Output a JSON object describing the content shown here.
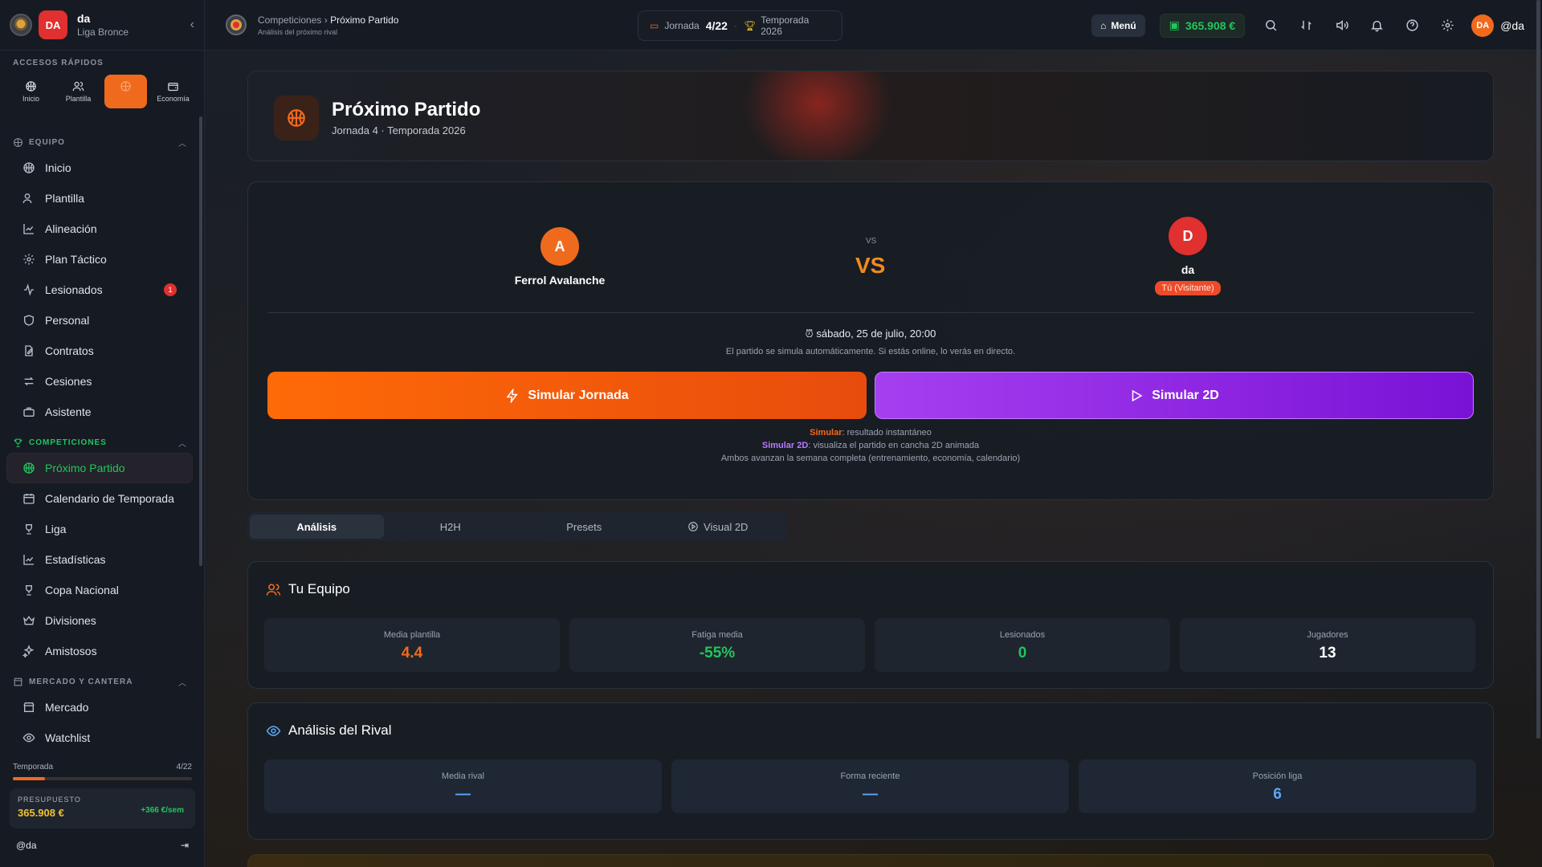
{
  "sidebar": {
    "club_name": "da",
    "league": "Liga Bronce",
    "avatar_initials": "DA",
    "quick_title": "Accesos rápidos",
    "quick": [
      {
        "label": "Inicio",
        "icon": "basketball-icon"
      },
      {
        "label": "Plantilla",
        "icon": "users-icon"
      },
      {
        "label": "Partido",
        "icon": "basketball-icon",
        "active": true
      },
      {
        "label": "Economía",
        "icon": "wallet-icon"
      }
    ],
    "group_equipo": "Equipo",
    "group_competiciones": "Competiciones",
    "group_mercado": "Mercado y cantera",
    "equipo_items": [
      "Inicio",
      "Plantilla",
      "Alineación",
      "Plan Táctico",
      "Lesionados",
      "Personal",
      "Contratos",
      "Cesiones",
      "Asistente"
    ],
    "lesionados_badge": "1",
    "competiciones_items": [
      "Próximo Partido",
      "Calendario de Temporada",
      "Liga",
      "Estadísticas",
      "Copa Nacional",
      "Divisiones",
      "Amistosos"
    ],
    "mercado_items": [
      "Mercado",
      "Watchlist"
    ],
    "season_label": "Temporada",
    "season_progress": "4/22",
    "season_fraction": 0.18,
    "budget_label": "Presupuesto",
    "budget_value": "365.908 €",
    "budget_weekly": "+366 €/sem",
    "handle": "@da"
  },
  "topbar": {
    "crumb_parent": "Competiciones",
    "crumb_current": "Próximo Partido",
    "crumb_sub": "Análisis del próximo rival",
    "jornada_label": "Jornada",
    "jornada_value": "4/22",
    "temporada": "Temporada 2026",
    "menu_label": "Menú",
    "money": "365.908 €",
    "avatar_initials": "DA",
    "handle": "@da"
  },
  "hero": {
    "title": "Próximo Partido",
    "subtitle": "Jornada 4 · Temporada 2026"
  },
  "match": {
    "home_initial": "A",
    "home_name": "Ferrol Avalanche",
    "home_color": "#f06a1e",
    "away_initial": "D",
    "away_name": "da",
    "away_color": "#e0302f",
    "away_tag": "Tú (Visitante)",
    "vs_small": "VS",
    "vs_big": "VS",
    "datetime": "sábado, 25 de julio, 20:00",
    "note": "El partido se simula automáticamente. Si estás online, lo verás en directo.",
    "simulate_label": "Simular Jornada",
    "simulate2d_label": "Simular 2D",
    "legend_sim_key": "Simular",
    "legend_sim_text": ": resultado instantáneo",
    "legend_2d_key": "Simular 2D",
    "legend_2d_text": ": visualiza el partido en cancha 2D animada",
    "legend_line3": "Ambos avanzan la semana completa (entrenamiento, economía, calendario)"
  },
  "tabs": [
    "Análisis",
    "H2H",
    "Presets",
    "Visual 2D"
  ],
  "your_team": {
    "title": "Tu Equipo",
    "stats": [
      {
        "label": "Media plantilla",
        "value": "4.4",
        "color": "#f06a1e"
      },
      {
        "label": "Fatiga media",
        "value": "-55%",
        "color": "#22c55e"
      },
      {
        "label": "Lesionados",
        "value": "0",
        "color": "#22c55e"
      },
      {
        "label": "Jugadores",
        "value": "13",
        "color": "#ffffff"
      }
    ]
  },
  "rival": {
    "title": "Análisis del Rival",
    "stats": [
      {
        "label": "Media rival",
        "value": "—",
        "color": "#60a5fa"
      },
      {
        "label": "Forma reciente",
        "value": "—",
        "color": "#60a5fa"
      },
      {
        "label": "Posición liga",
        "value": "6",
        "color": "#60a5fa"
      }
    ]
  }
}
